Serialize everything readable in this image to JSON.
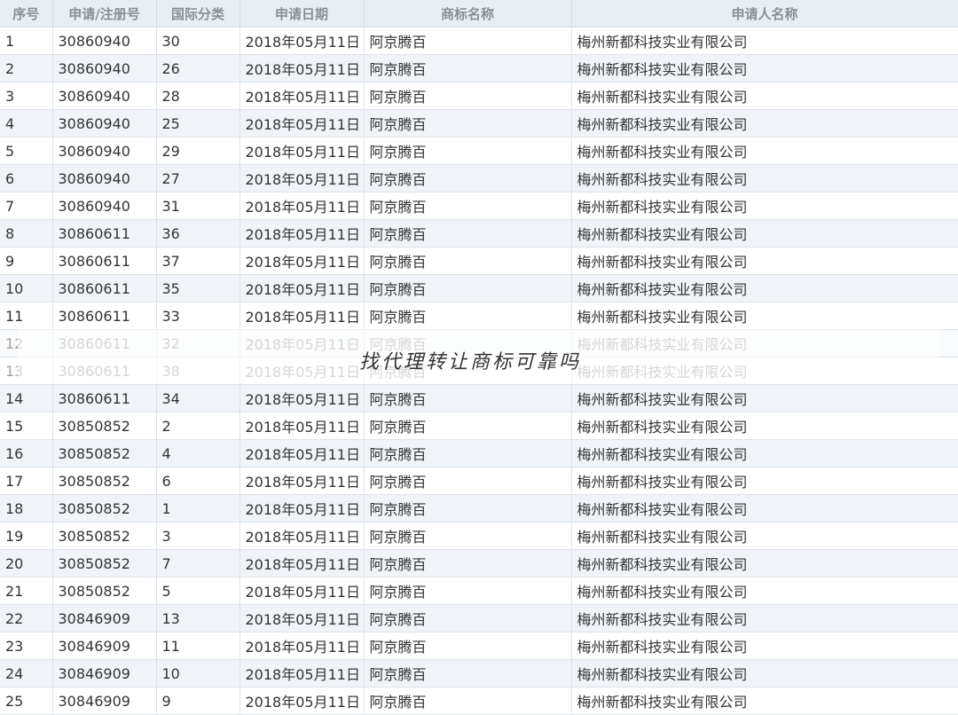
{
  "table": {
    "headers": [
      "序号",
      "申请/注册号",
      "国际分类",
      "申请日期",
      "商标名称",
      "申请人名称"
    ],
    "rows": [
      [
        "1",
        "30860940",
        "30",
        "2018年05月11日",
        "阿京腾百",
        "梅州新都科技实业有限公司"
      ],
      [
        "2",
        "30860940",
        "26",
        "2018年05月11日",
        "阿京腾百",
        "梅州新都科技实业有限公司"
      ],
      [
        "3",
        "30860940",
        "28",
        "2018年05月11日",
        "阿京腾百",
        "梅州新都科技实业有限公司"
      ],
      [
        "4",
        "30860940",
        "25",
        "2018年05月11日",
        "阿京腾百",
        "梅州新都科技实业有限公司"
      ],
      [
        "5",
        "30860940",
        "29",
        "2018年05月11日",
        "阿京腾百",
        "梅州新都科技实业有限公司"
      ],
      [
        "6",
        "30860940",
        "27",
        "2018年05月11日",
        "阿京腾百",
        "梅州新都科技实业有限公司"
      ],
      [
        "7",
        "30860940",
        "31",
        "2018年05月11日",
        "阿京腾百",
        "梅州新都科技实业有限公司"
      ],
      [
        "8",
        "30860611",
        "36",
        "2018年05月11日",
        "阿京腾百",
        "梅州新都科技实业有限公司"
      ],
      [
        "9",
        "30860611",
        "37",
        "2018年05月11日",
        "阿京腾百",
        "梅州新都科技实业有限公司"
      ],
      [
        "10",
        "30860611",
        "35",
        "2018年05月11日",
        "阿京腾百",
        "梅州新都科技实业有限公司"
      ],
      [
        "11",
        "30860611",
        "33",
        "2018年05月11日",
        "阿京腾百",
        "梅州新都科技实业有限公司"
      ],
      [
        "12",
        "30860611",
        "32",
        "2018年05月11日",
        "阿京腾百",
        "梅州新都科技实业有限公司"
      ],
      [
        "13",
        "30860611",
        "38",
        "2018年05月11日",
        "阿京腾百",
        "梅州新都科技实业有限公司"
      ],
      [
        "14",
        "30860611",
        "34",
        "2018年05月11日",
        "阿京腾百",
        "梅州新都科技实业有限公司"
      ],
      [
        "15",
        "30850852",
        "2",
        "2018年05月11日",
        "阿京腾百",
        "梅州新都科技实业有限公司"
      ],
      [
        "16",
        "30850852",
        "4",
        "2018年05月11日",
        "阿京腾百",
        "梅州新都科技实业有限公司"
      ],
      [
        "17",
        "30850852",
        "6",
        "2018年05月11日",
        "阿京腾百",
        "梅州新都科技实业有限公司"
      ],
      [
        "18",
        "30850852",
        "1",
        "2018年05月11日",
        "阿京腾百",
        "梅州新都科技实业有限公司"
      ],
      [
        "19",
        "30850852",
        "3",
        "2018年05月11日",
        "阿京腾百",
        "梅州新都科技实业有限公司"
      ],
      [
        "20",
        "30850852",
        "7",
        "2018年05月11日",
        "阿京腾百",
        "梅州新都科技实业有限公司"
      ],
      [
        "21",
        "30850852",
        "5",
        "2018年05月11日",
        "阿京腾百",
        "梅州新都科技实业有限公司"
      ],
      [
        "22",
        "30846909",
        "13",
        "2018年05月11日",
        "阿京腾百",
        "梅州新都科技实业有限公司"
      ],
      [
        "23",
        "30846909",
        "11",
        "2018年05月11日",
        "阿京腾百",
        "梅州新都科技实业有限公司"
      ],
      [
        "24",
        "30846909",
        "10",
        "2018年05月11日",
        "阿京腾百",
        "梅州新都科技实业有限公司"
      ],
      [
        "25",
        "30846909",
        "9",
        "2018年05月11日",
        "阿京腾百",
        "梅州新都科技实业有限公司"
      ]
    ]
  },
  "watermark": {
    "text": "找代理转让商标可靠吗"
  },
  "colors": {
    "header_bg": "#e9eef4",
    "stripe_bg": "#f0f4f8",
    "link": "#2f7bbd",
    "text": "#333333"
  }
}
